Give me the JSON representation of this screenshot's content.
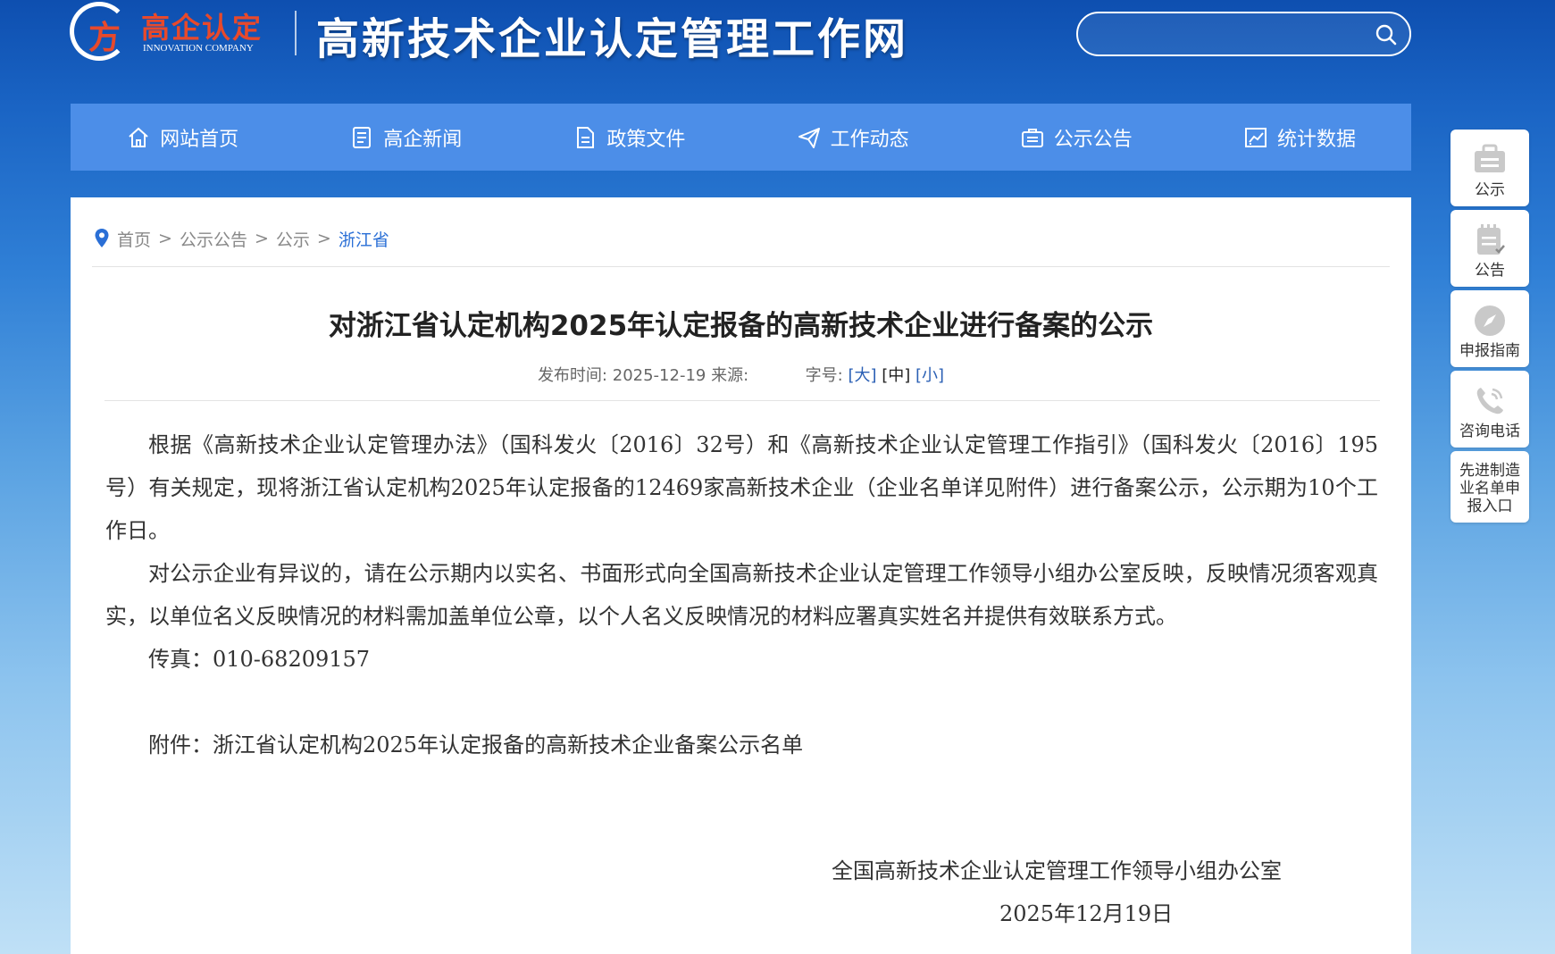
{
  "header": {
    "logo_cn": "高企认定",
    "logo_en": "INNOVATION COMPANY",
    "site_title": "高新技术企业认定管理工作网",
    "search_placeholder": ""
  },
  "nav": {
    "items": [
      {
        "label": "网站首页",
        "icon": "home-icon"
      },
      {
        "label": "高企新闻",
        "icon": "news-icon"
      },
      {
        "label": "政策文件",
        "icon": "document-icon"
      },
      {
        "label": "工作动态",
        "icon": "paper-plane-icon"
      },
      {
        "label": "公示公告",
        "icon": "briefcase-icon"
      },
      {
        "label": "统计数据",
        "icon": "chart-icon"
      }
    ]
  },
  "breadcrumb": {
    "items": [
      "首页",
      "公示公告",
      "公示",
      "浙江省"
    ],
    "separator": ">"
  },
  "article": {
    "title": "对浙江省认定机构2025年认定报备的高新技术企业进行备案的公示",
    "publish_label": "发布时间:",
    "publish_date": "2025-12-19",
    "source_label": "来源:",
    "font_size_label": "字号:",
    "font_sizes": [
      "[大]",
      "[中]",
      "[小]"
    ],
    "paragraphs": [
      "根据《高新技术企业认定管理办法》（国科发火〔2016〕32号）和《高新技术企业认定管理工作指引》（国科发火〔2016〕195号）有关规定，现将浙江省认定机构2025年认定报备的12469家高新技术企业（企业名单详见附件）进行备案公示，公示期为10个工作日。",
      "对公示企业有异议的，请在公示期内以实名、书面形式向全国高新技术企业认定管理工作领导小组办公室反映，反映情况须客观真实，以单位名义反映情况的材料需加盖单位公章，以个人名义反映情况的材料应署真实姓名并提供有效联系方式。",
      "传真：010-68209157"
    ],
    "attachment": "附件：浙江省认定机构2025年认定报备的高新技术企业备案公示名单",
    "signature_org": "全国高新技术企业认定管理工作领导小组办公室",
    "signature_date": "2025年12月19日"
  },
  "sidebar": {
    "items": [
      {
        "label": "公示",
        "icon": "briefcase-icon"
      },
      {
        "label": "公告",
        "icon": "notepad-icon"
      },
      {
        "label": "申报指南",
        "icon": "compass-icon"
      },
      {
        "label": "咨询电话",
        "icon": "phone-icon"
      },
      {
        "label": "先进制造业名单申报入口",
        "icon": ""
      }
    ]
  },
  "colors": {
    "nav_bg": "#4c8ee8",
    "link_blue": "#2a6fd6",
    "logo_red": "#e8492b"
  }
}
